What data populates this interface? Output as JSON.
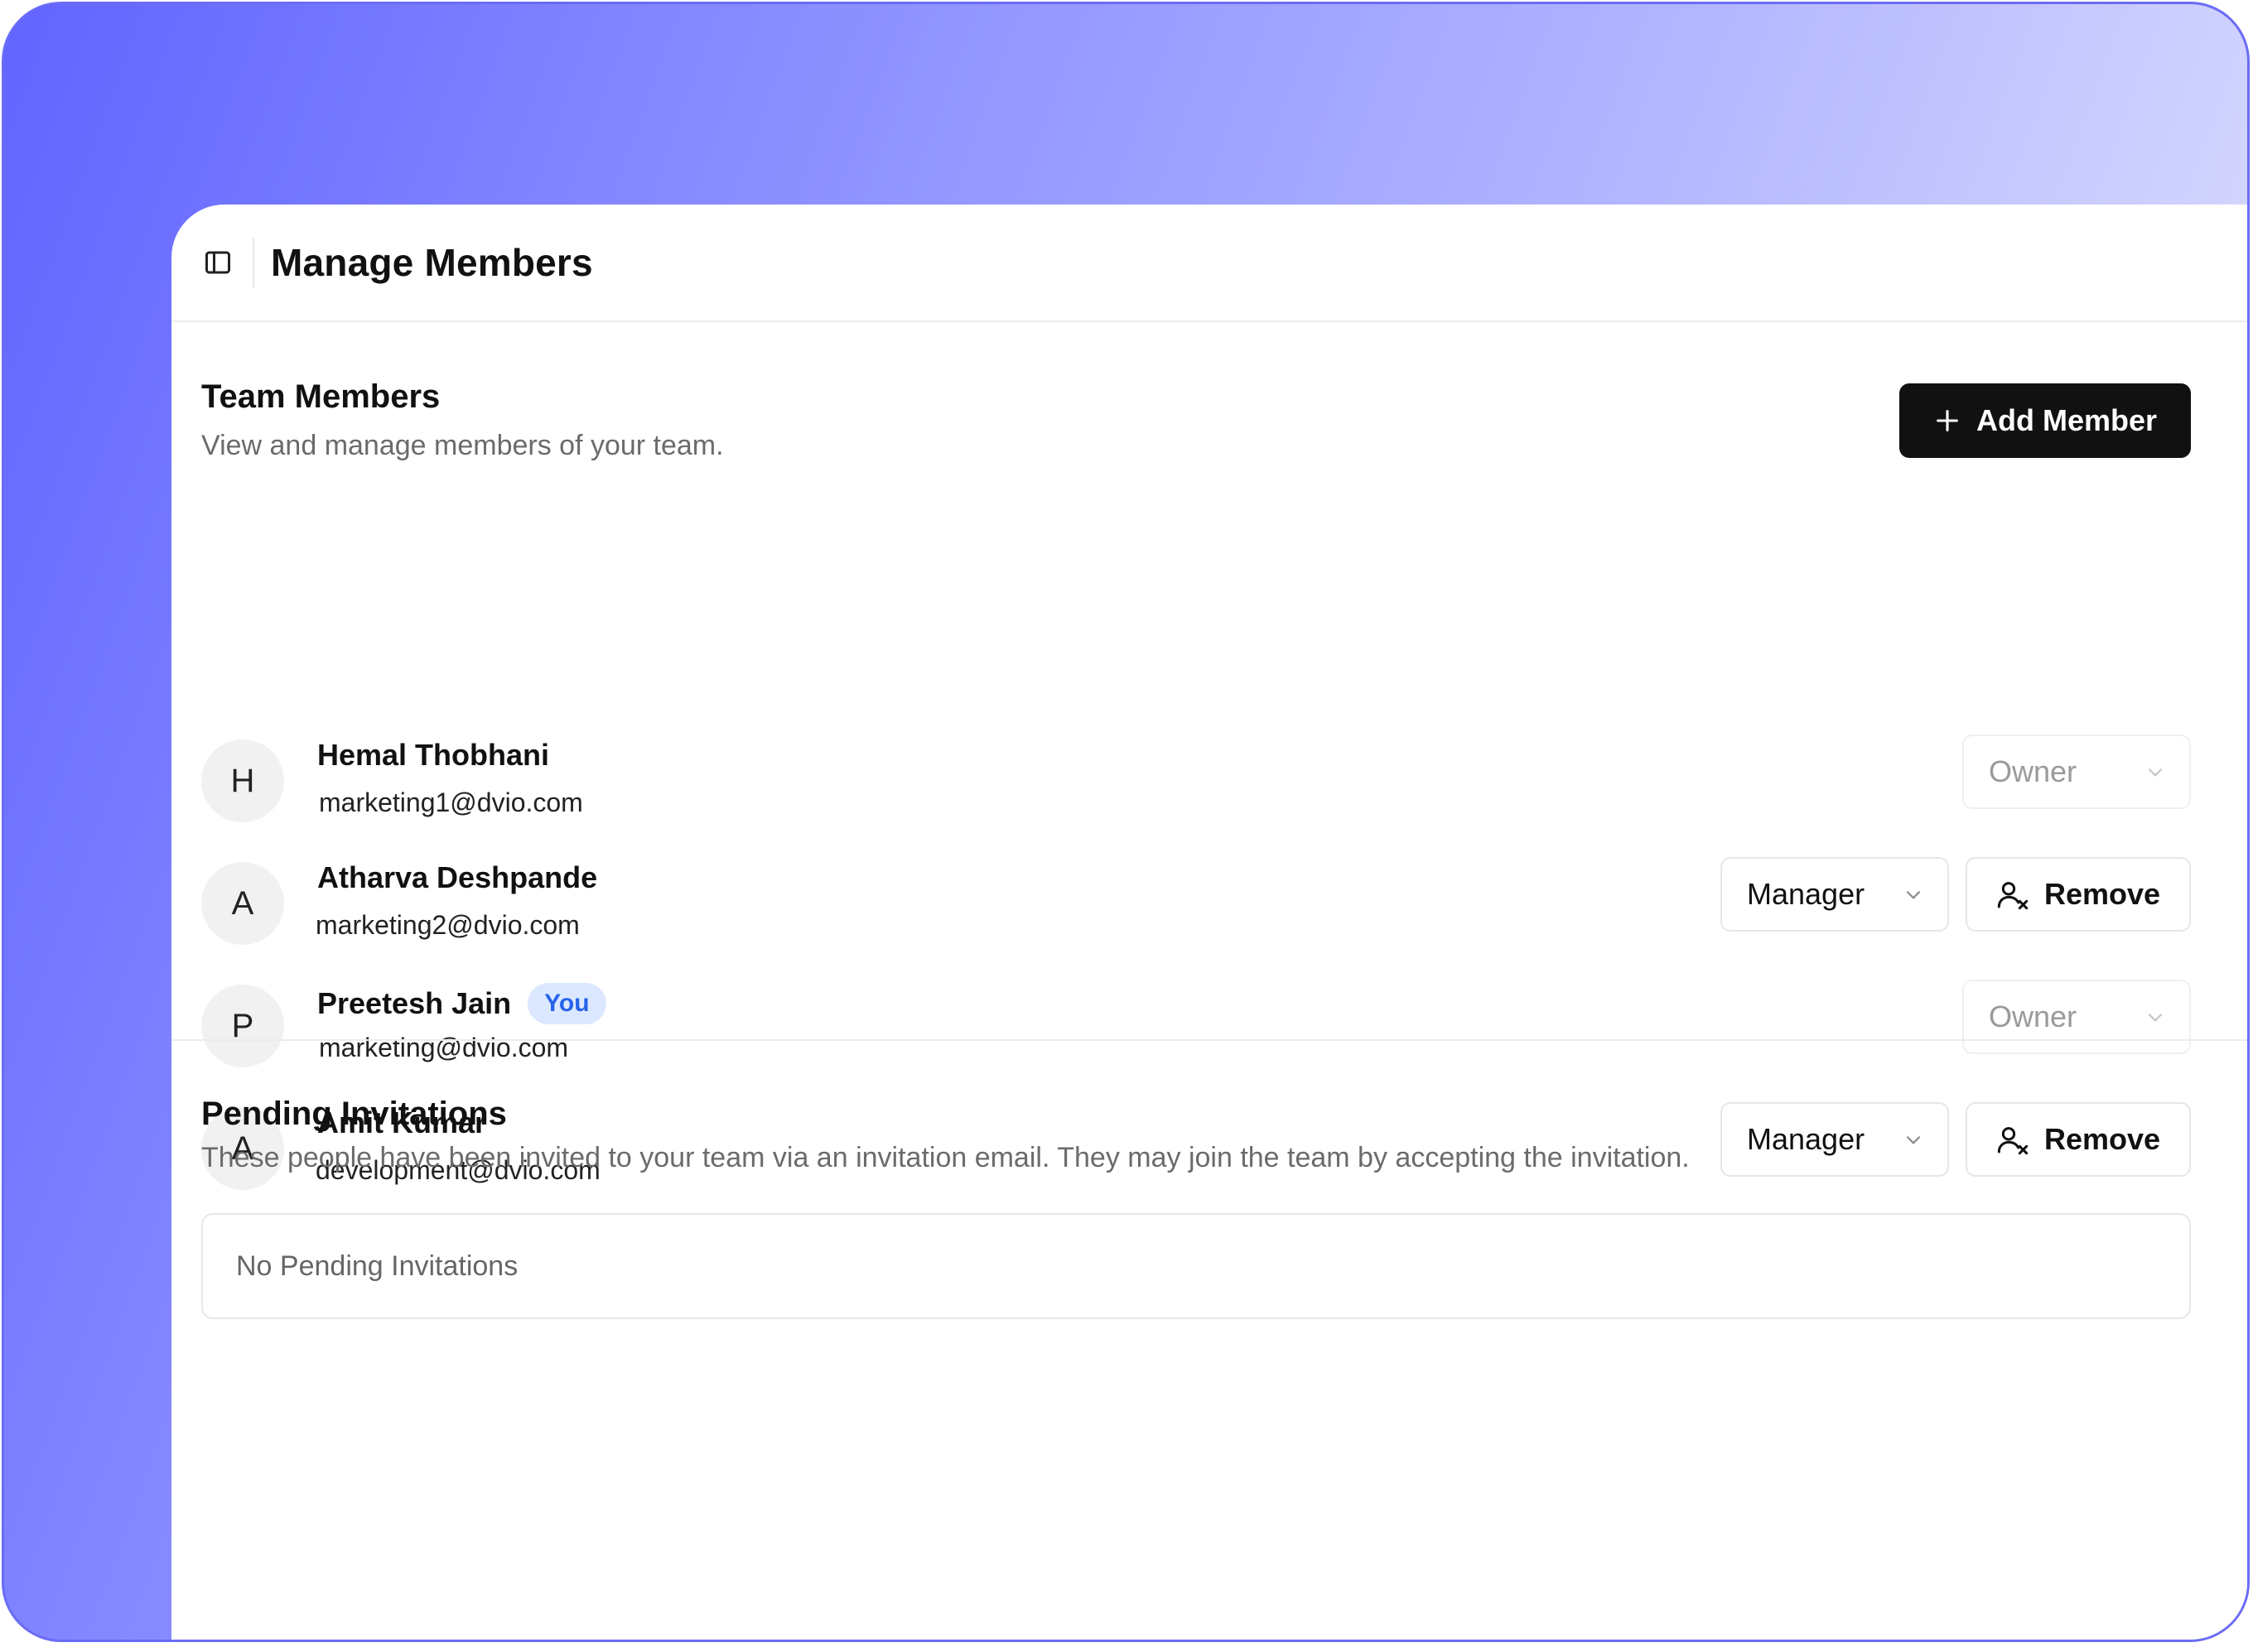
{
  "header": {
    "title": "Manage Members",
    "sidebar_toggle_icon": "sidebar-toggle-icon"
  },
  "team": {
    "title": "Team Members",
    "description": "View and manage members of your team.",
    "add_button_label": "Add Member",
    "members": [
      {
        "initial": "H",
        "name": "Hemal Thobhani",
        "email": "marketing1@dvio.com",
        "role": "Owner",
        "role_editable": false,
        "removable": false,
        "is_you": false
      },
      {
        "initial": "A",
        "name": "Atharva Deshpande",
        "email": "marketing2@dvio.com",
        "role": "Manager",
        "role_editable": true,
        "removable": true,
        "is_you": false
      },
      {
        "initial": "P",
        "name": "Preetesh Jain",
        "email": "marketing@dvio.com",
        "role": "Owner",
        "role_editable": false,
        "removable": false,
        "is_you": true,
        "badge": "You"
      },
      {
        "initial": "A",
        "name": "Amit Kumar",
        "email": "development@dvio.com",
        "role": "Manager",
        "role_editable": true,
        "removable": true,
        "is_you": false
      }
    ],
    "remove_label": "Remove"
  },
  "pending": {
    "title": "Pending Invitations",
    "description": "These people have been invited to your team via an invitation email. They may join the team by accepting the invitation.",
    "empty_text": "No Pending Invitations"
  },
  "colors": {
    "accent_gradient_start": "#6264ff",
    "accent_gradient_end": "#eceefc",
    "primary_button": "#111111",
    "you_badge_bg": "#dbe8ff",
    "you_badge_text": "#2563eb"
  }
}
